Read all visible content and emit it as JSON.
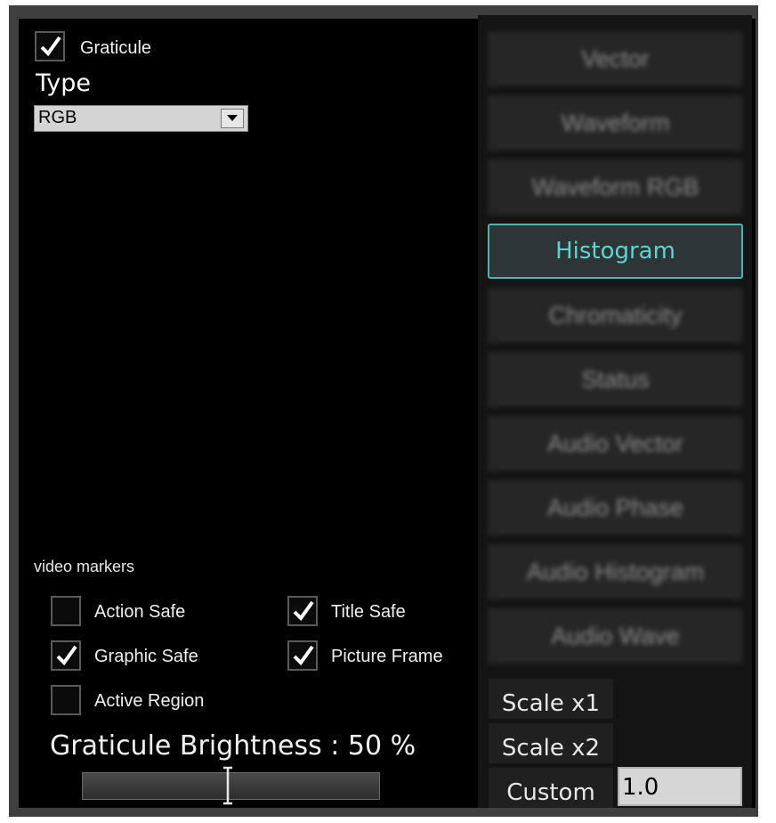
{
  "graticule": {
    "label": "Graticule",
    "checked": true
  },
  "type": {
    "label": "Type",
    "selected": "RGB"
  },
  "modes": [
    {
      "label": "Vector",
      "active": false
    },
    {
      "label": "Waveform",
      "active": false
    },
    {
      "label": "Waveform RGB",
      "active": false
    },
    {
      "label": "Histogram",
      "active": true
    },
    {
      "label": "Chromaticity",
      "active": false
    },
    {
      "label": "Status",
      "active": false
    },
    {
      "label": "Audio Vector",
      "active": false
    },
    {
      "label": "Audio Phase",
      "active": false
    },
    {
      "label": "Audio Histogram",
      "active": false
    },
    {
      "label": "Audio Wave",
      "active": false
    }
  ],
  "video_markers": {
    "label": "video markers",
    "items": [
      {
        "label": "Action Safe",
        "checked": false
      },
      {
        "label": "Title Safe",
        "checked": true
      },
      {
        "label": "Graphic Safe",
        "checked": true
      },
      {
        "label": "Picture Frame",
        "checked": true
      },
      {
        "label": "Active Region",
        "checked": false
      }
    ]
  },
  "brightness": {
    "label": "Graticule Brightness : 50 %",
    "value_percent": 50
  },
  "scale": {
    "x1": "Scale x1",
    "x2": "Scale x2",
    "custom": "Custom",
    "custom_value": "1.0"
  },
  "colors": {
    "accent": "#4fb3b0",
    "accent_text": "#5ed3cf",
    "panel_bg": "#000000"
  }
}
